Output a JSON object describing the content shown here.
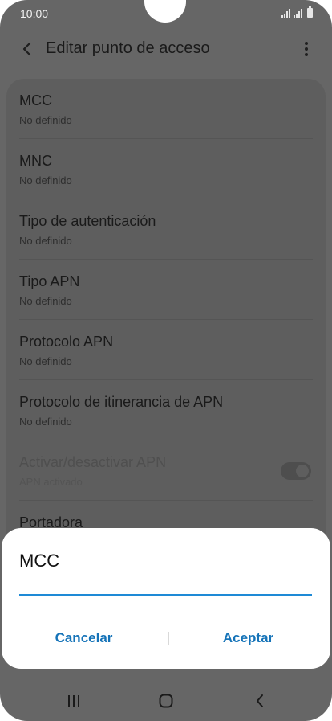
{
  "status_bar": {
    "time": "10:00"
  },
  "header": {
    "title": "Editar punto de acceso"
  },
  "settings": [
    {
      "title": "MCC",
      "value": "No definido"
    },
    {
      "title": "MNC",
      "value": "No definido"
    },
    {
      "title": "Tipo de autenticación",
      "value": "No definido"
    },
    {
      "title": "Tipo APN",
      "value": "No definido"
    },
    {
      "title": "Protocolo APN",
      "value": "No definido"
    },
    {
      "title": "Protocolo de itinerancia de APN",
      "value": "No definido"
    },
    {
      "title": "Activar/desactivar APN",
      "value": "APN activado",
      "toggle_on": true,
      "disabled": true
    },
    {
      "title": "Portadora",
      "value": ""
    }
  ],
  "dialog": {
    "title": "MCC",
    "input_value": "",
    "cancel_label": "Cancelar",
    "accept_label": "Aceptar"
  },
  "colors": {
    "accent": "#1e8ad6",
    "button_text": "#1573b8",
    "scrim": "#666666"
  },
  "icons": {
    "back": "chevron-left-icon",
    "more": "more-vertical-icon",
    "nav_recent": "recent-apps-icon",
    "nav_home": "home-icon",
    "nav_back": "nav-back-icon"
  }
}
